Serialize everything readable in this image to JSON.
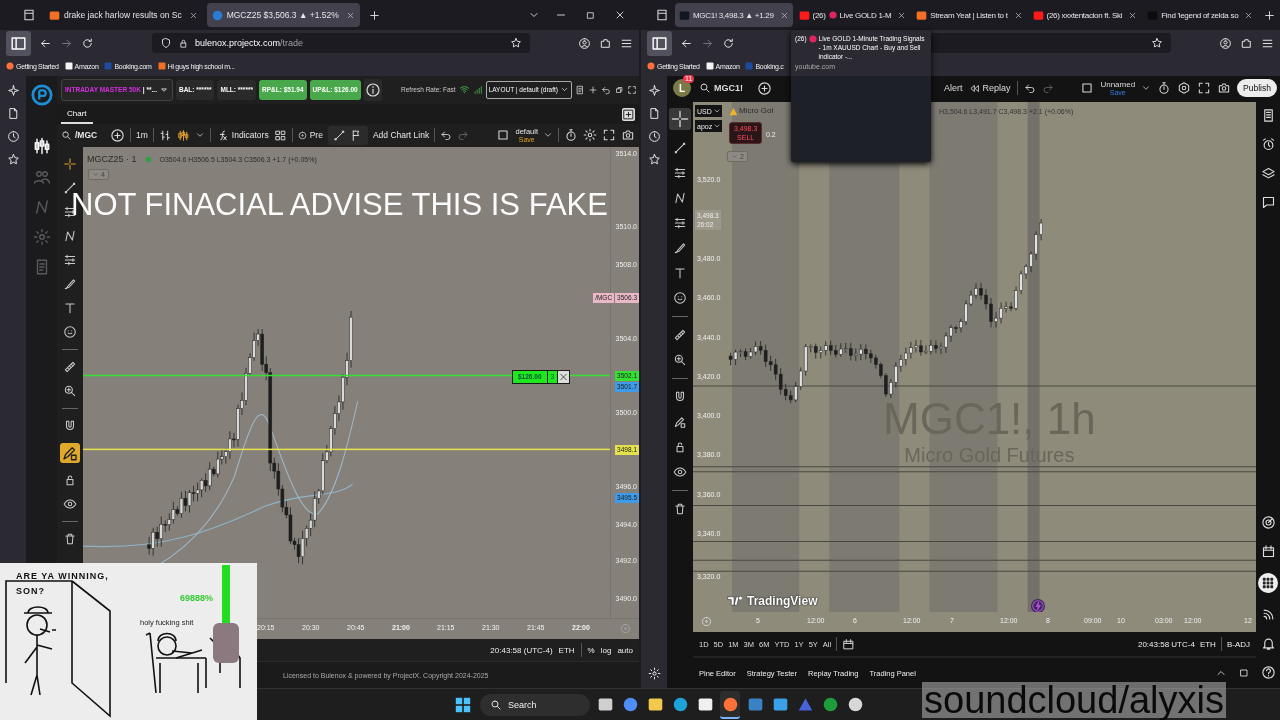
{
  "windows": [
    {
      "tabs": [
        {
          "title": "drake jack harlow results on Sc",
          "kind": "soundcloud",
          "selected": false
        },
        {
          "title": "MGCZ25 $3,506.3 ▲ +1.52%",
          "kind": "projectx",
          "selected": true
        }
      ],
      "url": {
        "host": "bulenox.projectx.com",
        "path": "/trade"
      },
      "bookmarks": [
        {
          "label": "Getting Started",
          "kind": "firefox"
        },
        {
          "label": "Amazon",
          "kind": "amazon"
        },
        {
          "label": "Booking.com",
          "kind": "booking"
        },
        {
          "label": "Hi guys high school m...",
          "kind": "soundcloud"
        }
      ]
    },
    {
      "tabs": [
        {
          "title": "MGC1! 3,498.3 ▲ +1.29",
          "kind": "tradingview",
          "selected": true
        },
        {
          "count": "(26)",
          "live": true,
          "title": "Live GOLD 1-M",
          "kind": "youtube",
          "selected": false
        },
        {
          "title": "Stream Yeat | Listen to t",
          "kind": "soundcloud",
          "selected": false
        },
        {
          "count": "(26)",
          "live": false,
          "title": "xxxtentacion ft. Ski",
          "kind": "youtube",
          "selected": false
        },
        {
          "title": "Find 'legend of zelda so",
          "kind": "tiktok",
          "selected": false
        }
      ],
      "bookmarks": [
        {
          "label": "Getting Started",
          "kind": "firefox"
        },
        {
          "label": "Amazon",
          "kind": "amazon"
        },
        {
          "label": "Booking.c",
          "kind": "booking"
        }
      ]
    }
  ],
  "tooltip": {
    "count": "(26)",
    "live": true,
    "title": "Live GOLD 1-Minute Trading Signals - 1m XAUUSD Chart - Buy and Sell indicator -...",
    "site": "youtube.com"
  },
  "left_app": {
    "account": {
      "name": "INTRADAY MASTER 50K",
      "suffix": "| **..."
    },
    "stats": [
      {
        "label": "BAL: ******",
        "kind": "plain"
      },
      {
        "label": "MLL: ******",
        "kind": "plain"
      },
      {
        "label": "RP&L: $51.94",
        "kind": "profit"
      },
      {
        "label": "UP&L: $126.00",
        "kind": "profit"
      }
    ],
    "refresh": "Refresh Rate: Fast",
    "layout": "LAYOUT | default (draft)",
    "tabs": [
      {
        "label": "Chart",
        "selected": true
      }
    ],
    "toolbar": {
      "symbol": "/MGC",
      "interval": "1m",
      "indicators": "Indicators",
      "pre": "Pre",
      "chart_link": "Add Chart Link",
      "template": "default",
      "save": "Save"
    },
    "legend": {
      "symbol": "MGCZ25 · 1",
      "ohlc": "O3504.6 H3506.5 L3504.3 C3506.3 +1.7 (+0.05%)",
      "collapse": "4"
    },
    "price_ticks": [
      "3514.0",
      "3510.0",
      "3508.0",
      "3504.0",
      "3500.0",
      "3496.0",
      "3494.0",
      "3492.0",
      "3490.0"
    ],
    "price_labels": [
      {
        "tag": "/MGC",
        "value": "3506.3",
        "color": "#e9b7c6"
      },
      {
        "value": "3502.1",
        "color": "#35e035"
      },
      {
        "value": "3501.7",
        "color": "#3d9be9"
      },
      {
        "value": "3498.1",
        "color": "#e6e24c"
      },
      {
        "value": "3495.5",
        "color": "#3d9be9"
      }
    ],
    "price_lines": [
      {
        "color": "#35e035"
      },
      {
        "color": "#e6e24c"
      }
    ],
    "position": {
      "pnl": "$126.00",
      "qty": "3"
    },
    "time_ticks": [
      {
        "label": "20:15",
        "major": false
      },
      {
        "label": "20:30",
        "major": false
      },
      {
        "label": "20:45",
        "major": false
      },
      {
        "label": "21:00",
        "major": true
      },
      {
        "label": "21:15",
        "major": false
      },
      {
        "label": "21:30",
        "major": false
      },
      {
        "label": "21:45",
        "major": false
      },
      {
        "label": "22:00",
        "major": true
      }
    ],
    "status": {
      "time": "20:43:58 (UTC-4)",
      "session": "ETH",
      "percent": "%",
      "log": "log",
      "auto": "auto"
    },
    "footer": "Licensed to Bulenox & powered by ProjectX. Copyright 2024-2025"
  },
  "right_app": {
    "avatar": "L",
    "notifications": "11",
    "symbol": "MGC1!",
    "alert": "Alert",
    "replay": "Replay",
    "layout_name": "Unnamed",
    "save": "Save",
    "publish": "Publish",
    "currency": "USD",
    "unit": "apoz",
    "legend_name": "Micro Gol",
    "ohlc": "H3,504.6 L3,491.7 C3,498.3 +2.1 (+0.06%)",
    "sell_price": "3,498.3",
    "sell_label": "SELL",
    "spread": "0.2",
    "collapse": "2",
    "price_ticks": [
      "3,520.0",
      "3,480.0",
      "3,460.0",
      "3,440.0",
      "3,420.0",
      "3,400.0",
      "3,380.0",
      "3,360.0",
      "3,340.0",
      "3,320.0"
    ],
    "last_price": "3,498.3",
    "countdown": "26:02",
    "watermark": {
      "title": "MGC1!, 1h",
      "subtitle": "Micro Gold Futures"
    },
    "brand": "TradingView",
    "time_ticks": [
      "5",
      "12:00",
      "6",
      "12:00",
      "7",
      "12:00",
      "8",
      "09:00",
      "10",
      "03:00",
      "12:00",
      "12"
    ],
    "ranges": [
      "1D",
      "5D",
      "1M",
      "3M",
      "6M",
      "YTD",
      "1Y",
      "5Y",
      "All"
    ],
    "status": {
      "time": "20:43:58 UTC-4",
      "session": "ETH",
      "adjust": "B-ADJ"
    },
    "panels": [
      "Pine Editor",
      "Strategy Tester",
      "Replay Trading",
      "Trading Panel"
    ]
  },
  "taskbar": {
    "search": "Search",
    "apps": [
      {
        "kind": "task-view",
        "active": false
      },
      {
        "kind": "copilot",
        "active": false
      },
      {
        "kind": "folder",
        "active": false
      },
      {
        "kind": "edge",
        "active": false
      },
      {
        "kind": "store",
        "active": false
      },
      {
        "kind": "firefox",
        "active": true
      },
      {
        "kind": "mouse",
        "active": false
      },
      {
        "kind": "monitor",
        "active": false
      },
      {
        "kind": "vpn",
        "active": false
      },
      {
        "kind": "xbox",
        "active": false
      },
      {
        "kind": "obs",
        "active": false
      }
    ]
  },
  "meme": {
    "question": "ARE YA WINNING, SON?",
    "gain": "69888%",
    "reply": "holy fucking shit"
  },
  "overlays": {
    "disclaimer": "NOT FINACIAL ADVISE THIS IS FAKE",
    "credit": "soundcloud/alyxis"
  }
}
